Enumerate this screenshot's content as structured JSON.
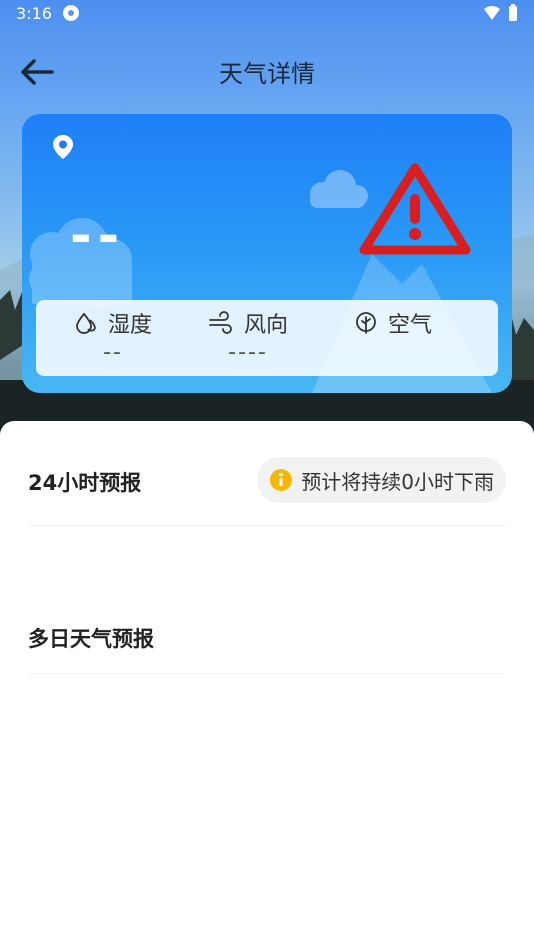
{
  "status_bar": {
    "time": "3:16"
  },
  "header": {
    "title": "天气详情"
  },
  "card": {
    "temperature": "--",
    "humidity": {
      "label": "湿度",
      "value": "--"
    },
    "wind": {
      "label": "风向",
      "value": "----"
    },
    "air": {
      "label": "空气",
      "value": ""
    }
  },
  "forecast_24h": {
    "title": "24小时预报",
    "rain_notice": "预计将持续0小时下雨"
  },
  "multi_day": {
    "title": "多日天气预报"
  },
  "colors": {
    "card_top": "#1e7ff7",
    "warning_red": "#d81e1e",
    "notice_yellow": "#f5b800"
  }
}
